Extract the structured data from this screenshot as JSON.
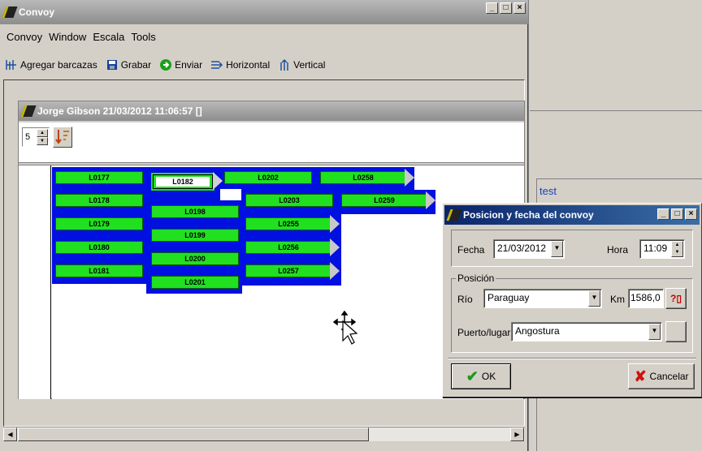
{
  "main_window": {
    "title": "Convoy",
    "menu": [
      "Convoy",
      "Window",
      "Escala",
      "Tools"
    ],
    "toolbar": {
      "agregar": "Agregar barcazas",
      "grabar": "Grabar",
      "enviar": "Enviar",
      "horizontal": "Horizontal",
      "vertical": "Vertical"
    }
  },
  "child_window": {
    "title": "Jorge Gibson 21/03/2012 11:06:57 []",
    "spinner_value": "5"
  },
  "right_panel": {
    "label": "test"
  },
  "barges": [
    {
      "id": "L0177"
    },
    {
      "id": "L0182"
    },
    {
      "id": "L0202"
    },
    {
      "id": "L0258"
    },
    {
      "id": "L0178"
    },
    {
      "id": "L0203"
    },
    {
      "id": "L0259"
    },
    {
      "id": "L0179"
    },
    {
      "id": "L0198"
    },
    {
      "id": "L0255"
    },
    {
      "id": "L0180"
    },
    {
      "id": "L0199"
    },
    {
      "id": "L0256"
    },
    {
      "id": "L0181"
    },
    {
      "id": "L0200"
    },
    {
      "id": "L0257"
    },
    {
      "id": "L0201"
    }
  ],
  "dialog": {
    "title": "Posicion y fecha del convoy",
    "fecha_label": "Fecha",
    "fecha_value": "21/03/2012",
    "hora_label": "Hora",
    "hora_value": "11:09",
    "group_label": "Posición",
    "rio_label": "Río",
    "rio_value": "Paraguay",
    "km_label": "Km",
    "km_value": "1586,0",
    "puerto_label": "Puerto/lugar",
    "puerto_value": "Angostura",
    "ok_label": "OK",
    "cancel_label": "Cancelar"
  },
  "colors": {
    "barge_green": "#20e020",
    "convoy_blue": "#0010e0",
    "titlebar_active": "#2a4a8c"
  }
}
